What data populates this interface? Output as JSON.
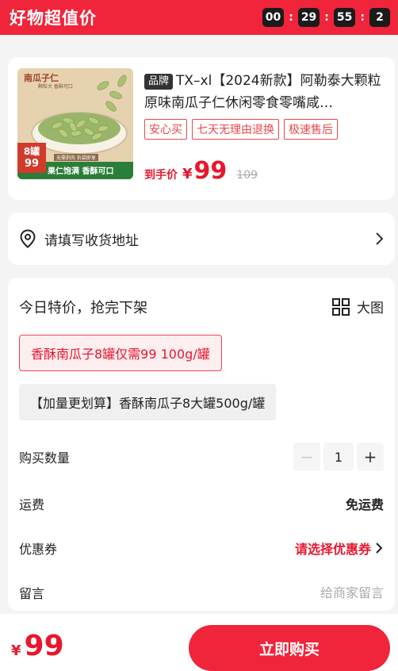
{
  "header": {
    "title": "好物超值价",
    "countdown": [
      "00",
      "29",
      "55",
      "2"
    ],
    "colors": {
      "bar": "#f0243a"
    }
  },
  "product": {
    "image": {
      "title": "南瓜子仁",
      "subtitle": "颗粒大 香酥可口",
      "badge_count": "8罐",
      "badge_price": "99",
      "note": "无需剥壳 拆袋即享",
      "banner": "果仁饱满 香酥可口"
    },
    "brand_tag": "品牌",
    "title": "TX–xl【2024新款】阿勒泰大颗粒原味南瓜子仁休闲零食零嘴咸…",
    "services": [
      "安心买",
      "七天无理由退换",
      "极速售后"
    ],
    "price_label": "到手价",
    "currency": "¥",
    "price": "99",
    "original_price": "109"
  },
  "address": {
    "label": "请填写收货地址",
    "icon": "location-pin-icon"
  },
  "options": {
    "heading": "今日特价，抢完下架",
    "view_toggle": "大图",
    "skus": [
      {
        "label": "香酥南瓜子8罐仅需99 100g/罐",
        "selected": true
      },
      {
        "label": "【加量更划算】香酥南瓜子8大罐500g/罐",
        "selected": false
      }
    ],
    "quantity_label": "购买数量",
    "quantity": "1",
    "minus": "−",
    "plus": "+",
    "shipping_label": "运费",
    "shipping_value": "免运费",
    "coupon_label": "优惠券",
    "coupon_value": "请选择优惠券",
    "message_label": "留言",
    "message_placeholder": "给商家留言"
  },
  "bottom_bar": {
    "currency": "¥",
    "price": "99",
    "buy_label": "立即购买"
  }
}
